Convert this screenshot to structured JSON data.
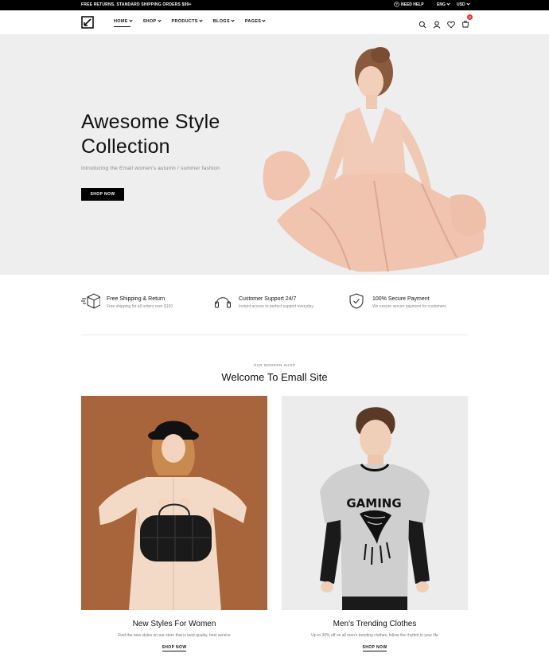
{
  "topbar": {
    "promo": "FREE RETURNS. STANDARD SHIPPING ORDERS $99+",
    "help": "NEED HELP",
    "language": "ENG",
    "currency": "USD"
  },
  "nav": {
    "items": [
      {
        "label": "HOME"
      },
      {
        "label": "SHOP"
      },
      {
        "label": "PRODUCTS"
      },
      {
        "label": "BLOGS"
      },
      {
        "label": "PAGES"
      }
    ],
    "cart_count": "0",
    "icons": [
      "search-icon",
      "user-icon",
      "heart-icon",
      "cart-icon"
    ]
  },
  "hero": {
    "title_line1": "Awesome Style",
    "title_line2": "Collection",
    "subtitle": "Introducing the Emall women's autumn / summer fashion",
    "button": "SHOP NOW"
  },
  "features": [
    {
      "icon": "shipping-box-icon",
      "title": "Free Shipping & Return",
      "desc": "Free shipping for all orders over $130"
    },
    {
      "icon": "headphones-icon",
      "title": "Customer Support 24/7",
      "desc": "Instant access to perfect support everyday"
    },
    {
      "icon": "shield-check-icon",
      "title": "100% Secure Payment",
      "desc": "We ensure secure payment for customers"
    }
  ],
  "welcome": {
    "eyebrow": "OUR MODERN SHOP",
    "title": "Welcome To Emall Site"
  },
  "cards": [
    {
      "title": "New Styles For Women",
      "desc": "Find the new styles on our store that is best quality, best service",
      "link": "SHOP NOW"
    },
    {
      "title": "Men's Trending Clothes",
      "desc": "Up to 30% off on all men's trending clothes, follow the rhythm in your life",
      "link": "SHOP NOW",
      "shirt_text": "GAMING"
    }
  ],
  "colors": {
    "topbar_bg": "#000000",
    "hero_bg": "#eeeeee",
    "badge": "#e53935",
    "women_card_bg": "#a8643a",
    "men_card_bg": "#ececec"
  }
}
